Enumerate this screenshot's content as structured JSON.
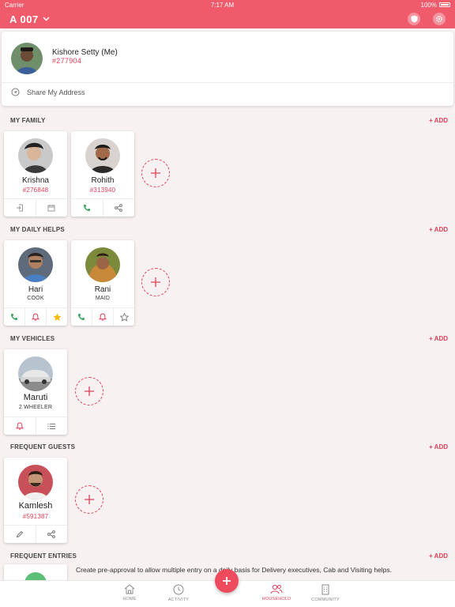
{
  "status_bar": {
    "carrier": "Carrier",
    "time": "7:17 AM",
    "battery": "100%"
  },
  "header": {
    "flat": "A 007"
  },
  "profile": {
    "name": "Kishore Setty (Me)",
    "code": "#277904",
    "share_label": "Share My Address"
  },
  "family": {
    "title": "MY FAMILY",
    "add": "+ ADD",
    "members": [
      {
        "name": "Krishna",
        "code": "#276848"
      },
      {
        "name": "Rohith",
        "code": "#313940"
      }
    ]
  },
  "daily_helps": {
    "title": "MY DAILY HELPS",
    "add": "+ ADD",
    "helps": [
      {
        "name": "Hari",
        "role": "COOK",
        "starred": true
      },
      {
        "name": "Rani",
        "role": "MAID",
        "starred": false
      }
    ]
  },
  "vehicles": {
    "title": "MY VEHICLES",
    "add": "+ ADD",
    "items": [
      {
        "name": "Maruti",
        "type": "2 WHEELER"
      }
    ]
  },
  "guests": {
    "title": "FREQUENT GUESTS",
    "add": "+ ADD",
    "items": [
      {
        "name": "Kamlesh",
        "code": "#591387"
      }
    ]
  },
  "entries": {
    "title": "FREQUENT ENTRIES",
    "add": "+ ADD",
    "description": "Create pre-approval to allow multiple entry on a daily basis for Delivery executives, Cab and Visiting helps."
  },
  "tabs": [
    {
      "label": "HOME",
      "icon": "home-icon"
    },
    {
      "label": "ACTIVITY",
      "icon": "clock-icon"
    },
    {
      "label": "HOUSEHOLD",
      "icon": "people-icon",
      "active": true
    },
    {
      "label": "COMMUNITY",
      "icon": "building-icon"
    }
  ],
  "colors": {
    "primary": "#ef5b6b",
    "accent": "#e0405a",
    "call": "#3aa55d",
    "star": "#f5b800"
  }
}
